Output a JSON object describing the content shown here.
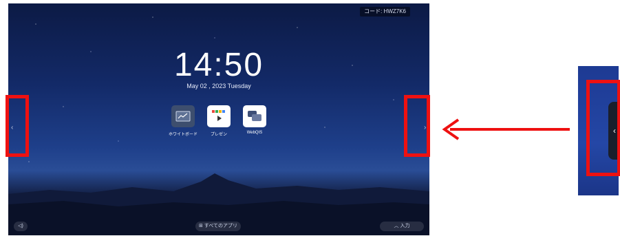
{
  "home_screen": {
    "code_badge": "コード: HWZ7K6",
    "clock": "14:50",
    "date": "May 02 , 2023 Tuesday",
    "apps": [
      {
        "label": "ホワイトボード",
        "icon": "whiteboard-icon"
      },
      {
        "label": "プレゼン",
        "icon": "presentation-icon"
      },
      {
        "label": "WebQIS",
        "icon": "chat-bubbles-icon"
      }
    ],
    "bottom_bar": {
      "left_icon": "sound-icon",
      "center_label": "すべてのアプリ",
      "right_label": "入力"
    }
  },
  "annotation": {
    "highlight_color": "#ee1111"
  }
}
